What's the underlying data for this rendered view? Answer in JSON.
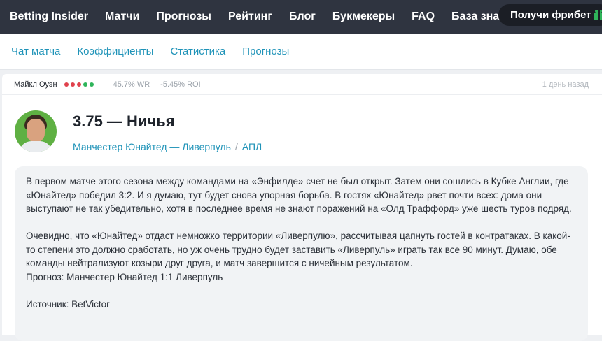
{
  "header": {
    "brand": "Betting Insider",
    "nav": [
      "Матчи",
      "Прогнозы",
      "Рейтинг",
      "Блог",
      "Букмекеры",
      "FAQ",
      "База знаний"
    ],
    "freebet_label": "Получи фрибет",
    "freebet_icon": "gift-icon"
  },
  "subnav": {
    "tabs": [
      "Чат матча",
      "Коэффициенты",
      "Статистика",
      "Прогнозы"
    ]
  },
  "post": {
    "author": "Майкл Оуэн",
    "form_dots": [
      "#e0414c",
      "#e0414c",
      "#e0414c",
      "#2fb45a",
      "#2fb45a"
    ],
    "win_rate": "45.7% WR",
    "roi": "-5.45% ROI",
    "time_ago": "1 день назад",
    "avatar_icon": "user-avatar",
    "title": "3.75 — Ничья",
    "match_link": "Манчестер Юнайтед — Ливерпуль",
    "league_link": "АПЛ",
    "paragraph1": "В первом матче этого сезона между командами на «Энфилде» счет не был открыт. Затем они сошлись в Кубке Англии, где «Юнайтед» победил 3:2. И я думаю, тут будет снова упорная борьба. В гостях «Юнайтед» рвет почти всех: дома они выступают не так убедительно, хотя в последнее время не знают поражений на «Олд Траффорд» уже шесть туров подряд.",
    "paragraph2": "Очевидно, что «Юнайтед» отдаст немножко территории «Ливерпулю», рассчитывая цапнуть гостей в контратаках. В какой-то степени это должно сработать, но уж очень трудно будет заставить «Ливерпуль» играть так все 90 минут. Думаю, обе команды нейтрализуют козыри друг друга, и матч завершится с ничейным результатом.",
    "forecast": "Прогноз: Манчестер Юнайтед 1:1 Ливерпуль",
    "source": "Источник: BetVictor"
  },
  "colors": {
    "header_bg": "#2f3440",
    "link": "#1f93b8",
    "accent_green": "#2fb45a"
  }
}
